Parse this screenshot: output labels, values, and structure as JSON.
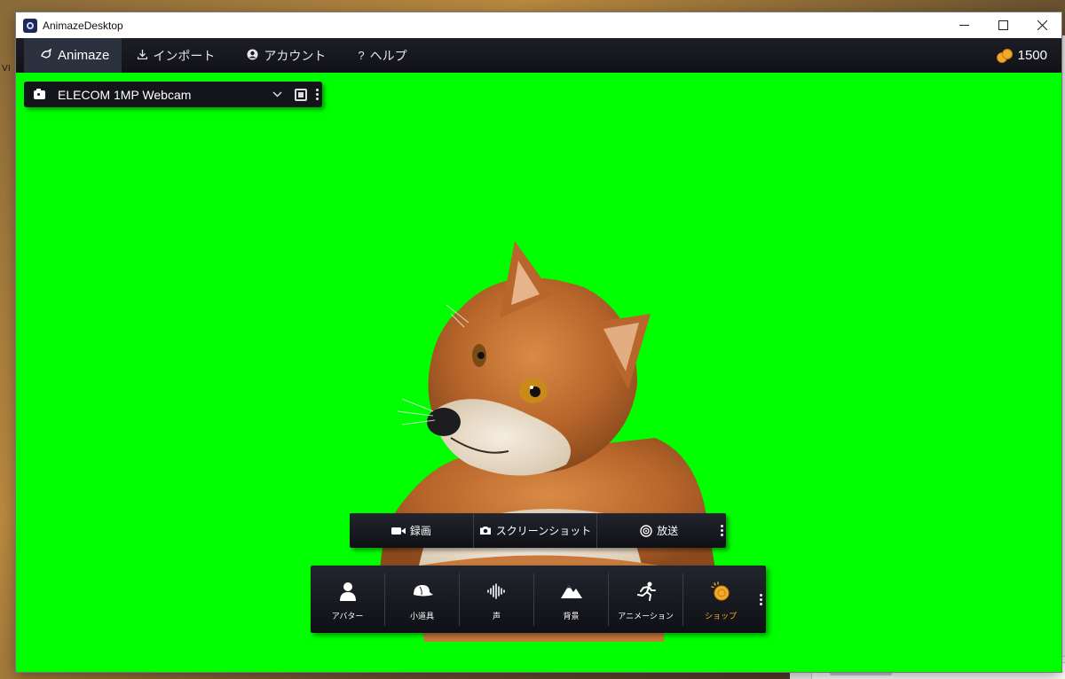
{
  "window": {
    "title": "AnimazeDesktop"
  },
  "desktop": {
    "left_edge_text": "VI"
  },
  "menu": {
    "items": [
      {
        "label": "Animaze",
        "icon": "animaze-logo-icon",
        "active": true
      },
      {
        "label": "インポート",
        "icon": "import-icon"
      },
      {
        "label": "アカウント",
        "icon": "account-icon"
      },
      {
        "label": "ヘルプ",
        "icon": "help-icon"
      }
    ],
    "coins": "1500"
  },
  "camera": {
    "selected": "ELECOM 1MP Webcam"
  },
  "record_bar": {
    "items": [
      {
        "label": "録画",
        "icon": "video-camera-icon"
      },
      {
        "label": "スクリーンショット",
        "icon": "camera-icon"
      },
      {
        "label": "放送",
        "icon": "broadcast-icon"
      }
    ]
  },
  "toolbar": {
    "items": [
      {
        "label": "アバター",
        "icon": "avatar-icon"
      },
      {
        "label": "小道具",
        "icon": "cap-icon"
      },
      {
        "label": "声",
        "icon": "voice-waveform-icon"
      },
      {
        "label": "背景",
        "icon": "mountain-icon"
      },
      {
        "label": "アニメーション",
        "icon": "running-icon"
      },
      {
        "label": "ショップ",
        "icon": "coin-icon"
      }
    ]
  },
  "colors": {
    "background": "#00ff00",
    "accent": "#f3a928",
    "bar": "#14151b"
  }
}
